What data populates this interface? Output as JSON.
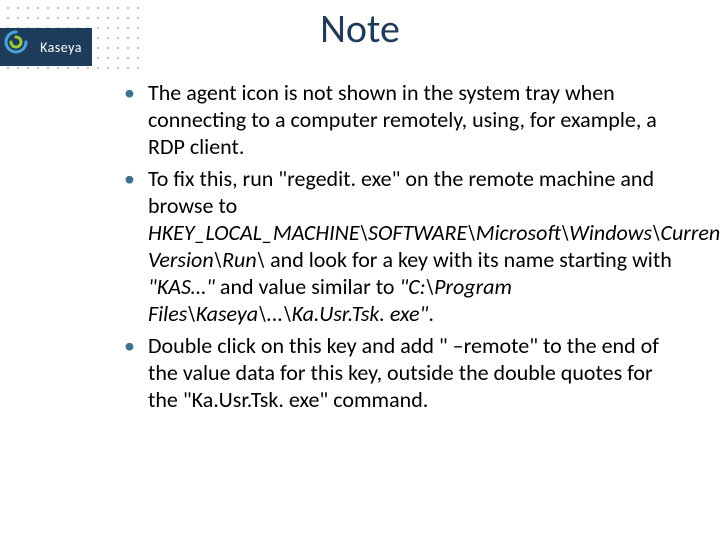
{
  "brand": {
    "name": "Kaseya"
  },
  "slide": {
    "title": "Note",
    "bullets": [
      {
        "text": "The agent icon is not shown in the system tray when connecting to a computer remotely, using, for example, a RDP client."
      },
      {
        "prefix": "To fix this, run \"regedit. exe\" on the remote machine and browse to ",
        "italic1": "HKEY_LOCAL_MACHINE\\SOFTWARE\\Microsoft\\Windows\\Current. Version\\Run\\",
        "mid1": " and look for a key with its name starting with ",
        "italic2": "\"KAS…\" ",
        "mid2": " and value similar to ",
        "italic3": "\"C:\\Program Files\\Kaseya\\...\\Ka.Usr.Tsk. exe\"",
        "suffix": "."
      },
      {
        "text": "Double click on this key and add \" –remote\" to the end of the value data for this key, outside the double quotes for the \"Ka.Usr.Tsk. exe\" command."
      }
    ]
  }
}
